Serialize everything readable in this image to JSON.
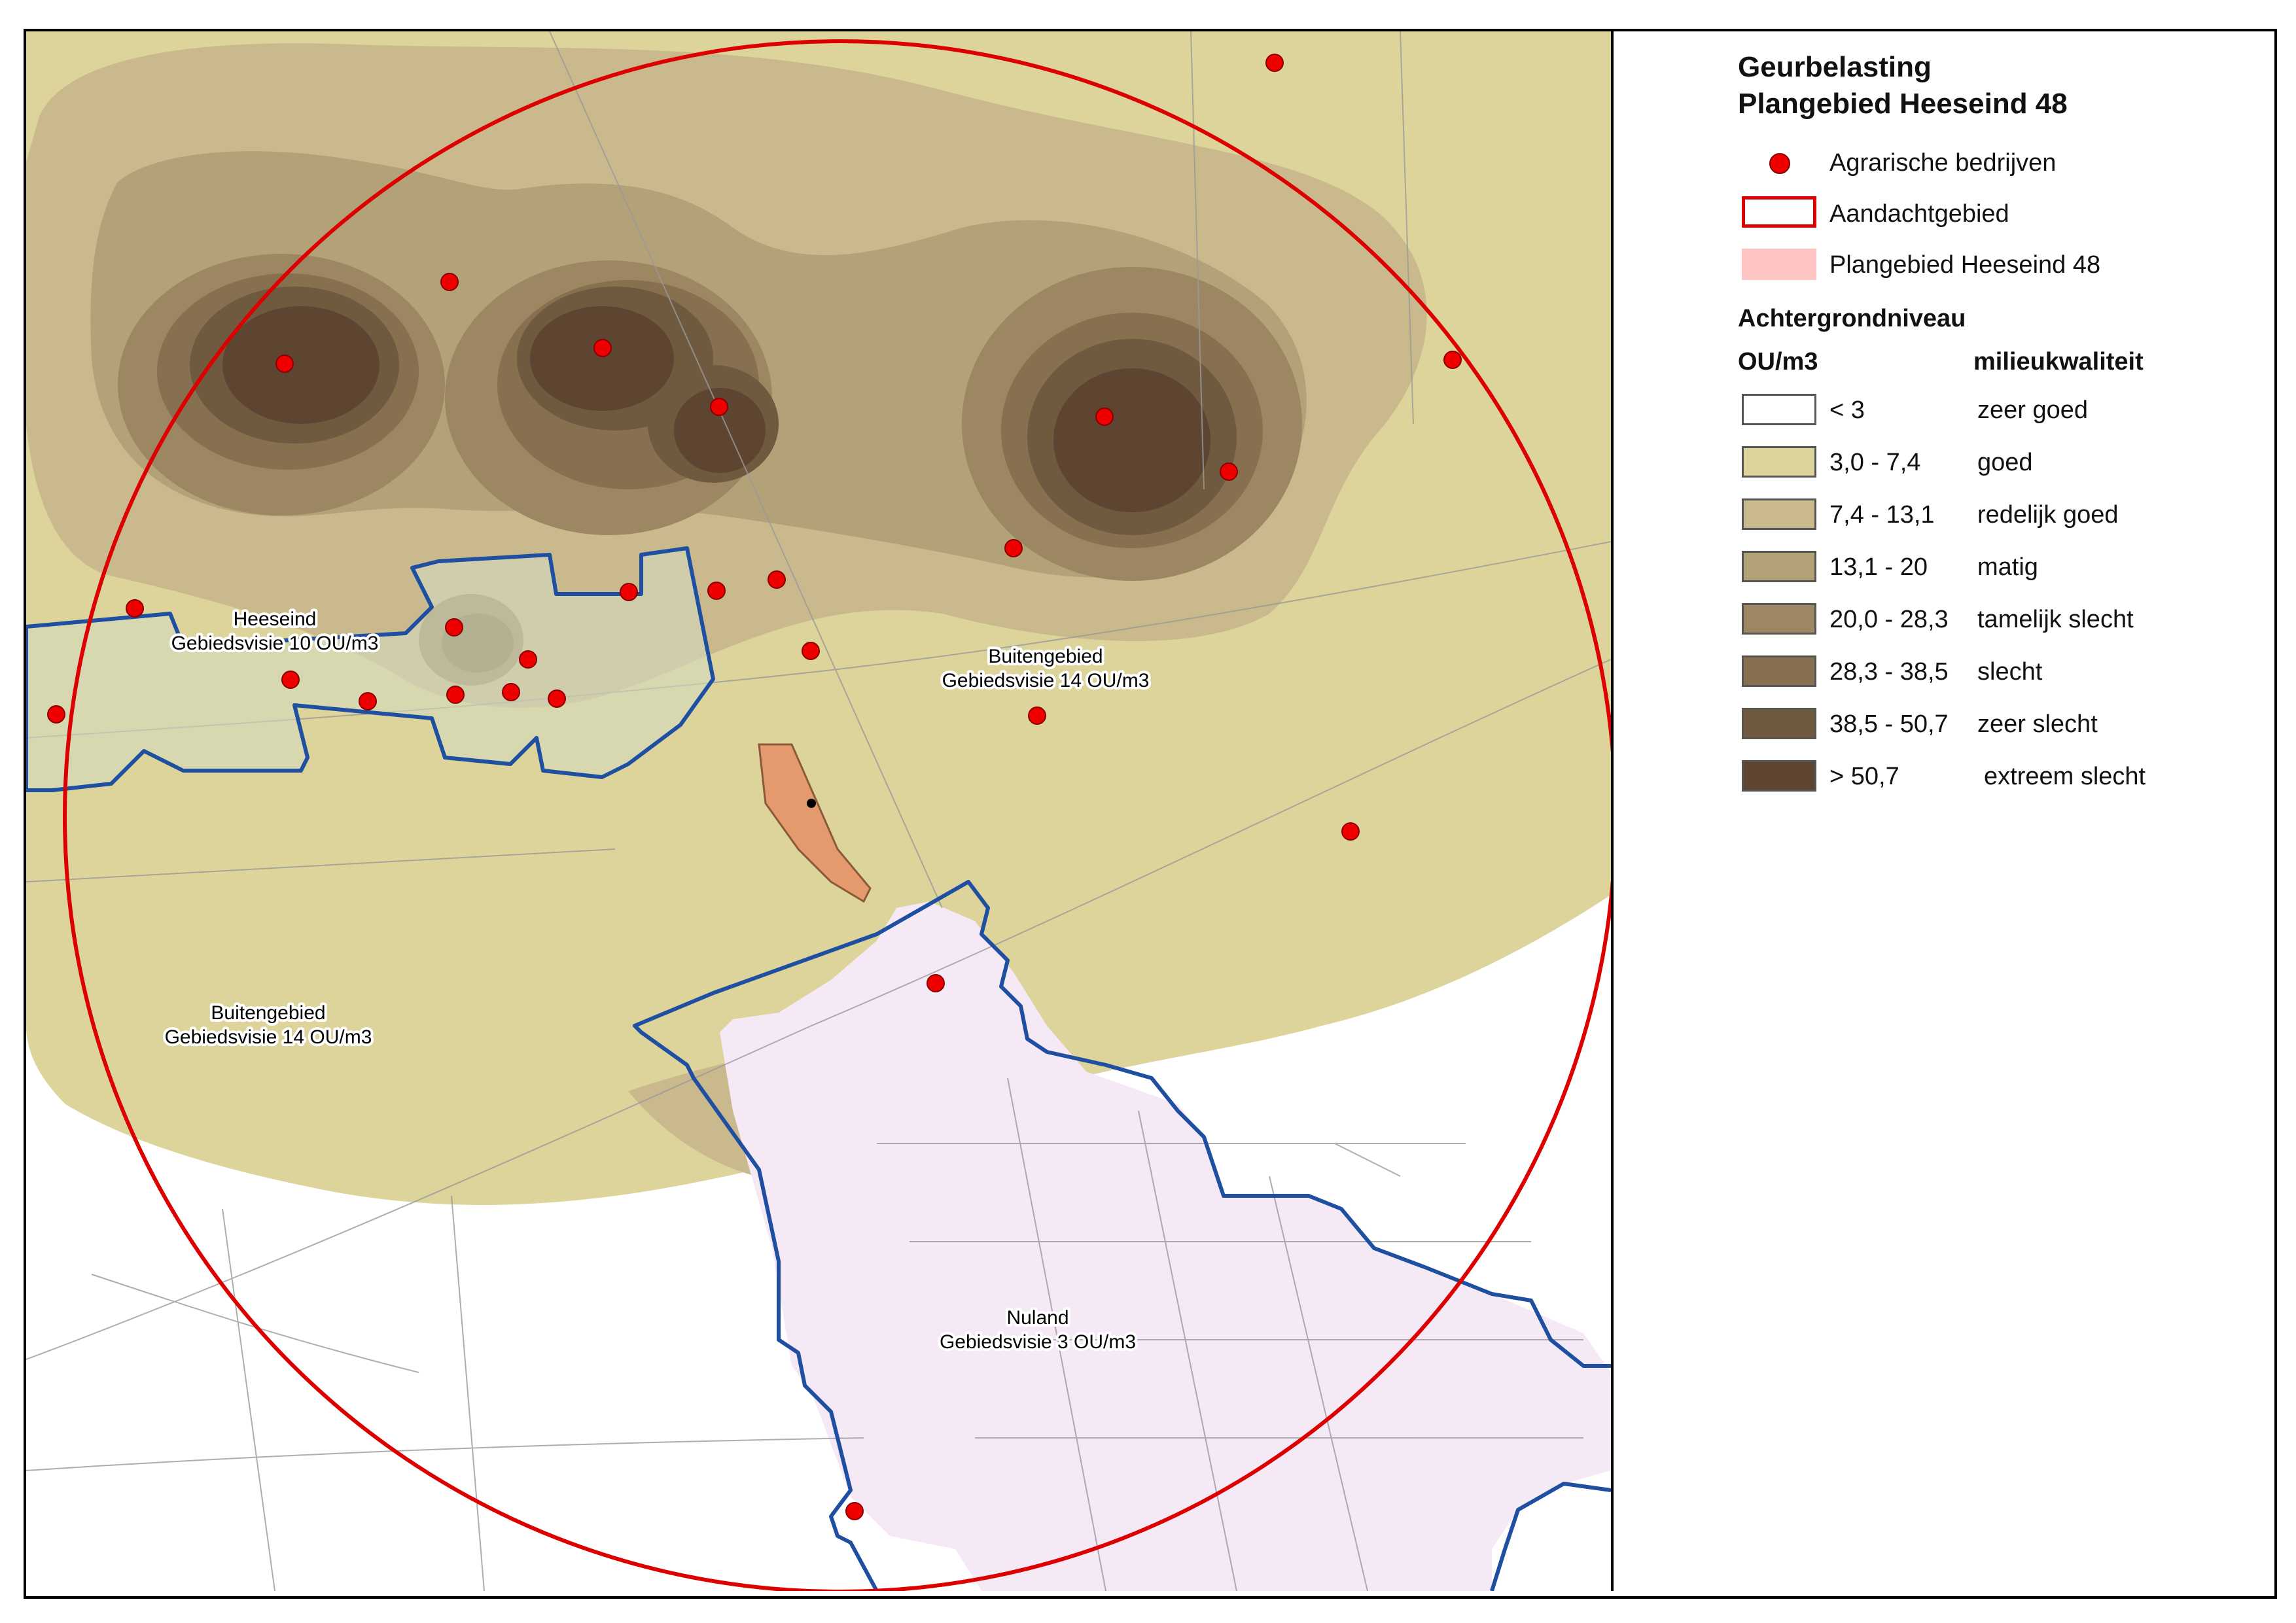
{
  "legend": {
    "title_line1": "Geurbelasting",
    "title_line2": "Plangebied Heeseind 48",
    "items": {
      "farms": "Agrarische bedrijven",
      "attention_area": "Aandachtgebied",
      "plan_area": "Plangebied Heeseind 48"
    },
    "section_title": "Achtergrondniveau",
    "col_unit": "OU/m3",
    "col_quality": "milieukwaliteit",
    "classes": [
      {
        "range": "< 3",
        "quality": "zeer goed",
        "color": "#ffffff"
      },
      {
        "range": "3,0 - 7,4",
        "quality": "goed",
        "color": "#dcd49a"
      },
      {
        "range": "7,4 - 13,1",
        "quality": "redelijk goed",
        "color": "#c9b98c"
      },
      {
        "range": "13,1 - 20",
        "quality": "matig",
        "color": "#b3a277"
      },
      {
        "range": "20,0 - 28,3",
        "quality": "tamelijk slecht",
        "color": "#9c8762"
      },
      {
        "range": "28,3 - 38,5",
        "quality": "slecht",
        "color": "#86704f"
      },
      {
        "range": "38,5 - 50,7",
        "quality": "zeer slecht",
        "color": "#705a3f"
      },
      {
        "range": "> 50,7",
        "quality": "extreem slecht",
        "color": "#5d4532"
      }
    ],
    "farm_color": "#ee0000",
    "attention_color": "#dd0000",
    "plan_color": "#ffc4c4"
  },
  "map": {
    "labels": {
      "heeseind_name": "Heeseind",
      "heeseind_vision": "Gebiedsvisie 10 OU/m3",
      "buiten_ne_name": "Buitengebied",
      "buiten_ne_vision": "Gebiedsvisie 14 OU/m3",
      "buiten_sw_name": "Buitengebied",
      "buiten_sw_vision": "Gebiedsvisie 14 OU/m3",
      "nuland_name": "Nuland",
      "nuland_vision": "Gebiedsvisie 3 OU/m3"
    },
    "boundary_color": "#1f4fa0",
    "plan_fill": "#e49a6c"
  }
}
